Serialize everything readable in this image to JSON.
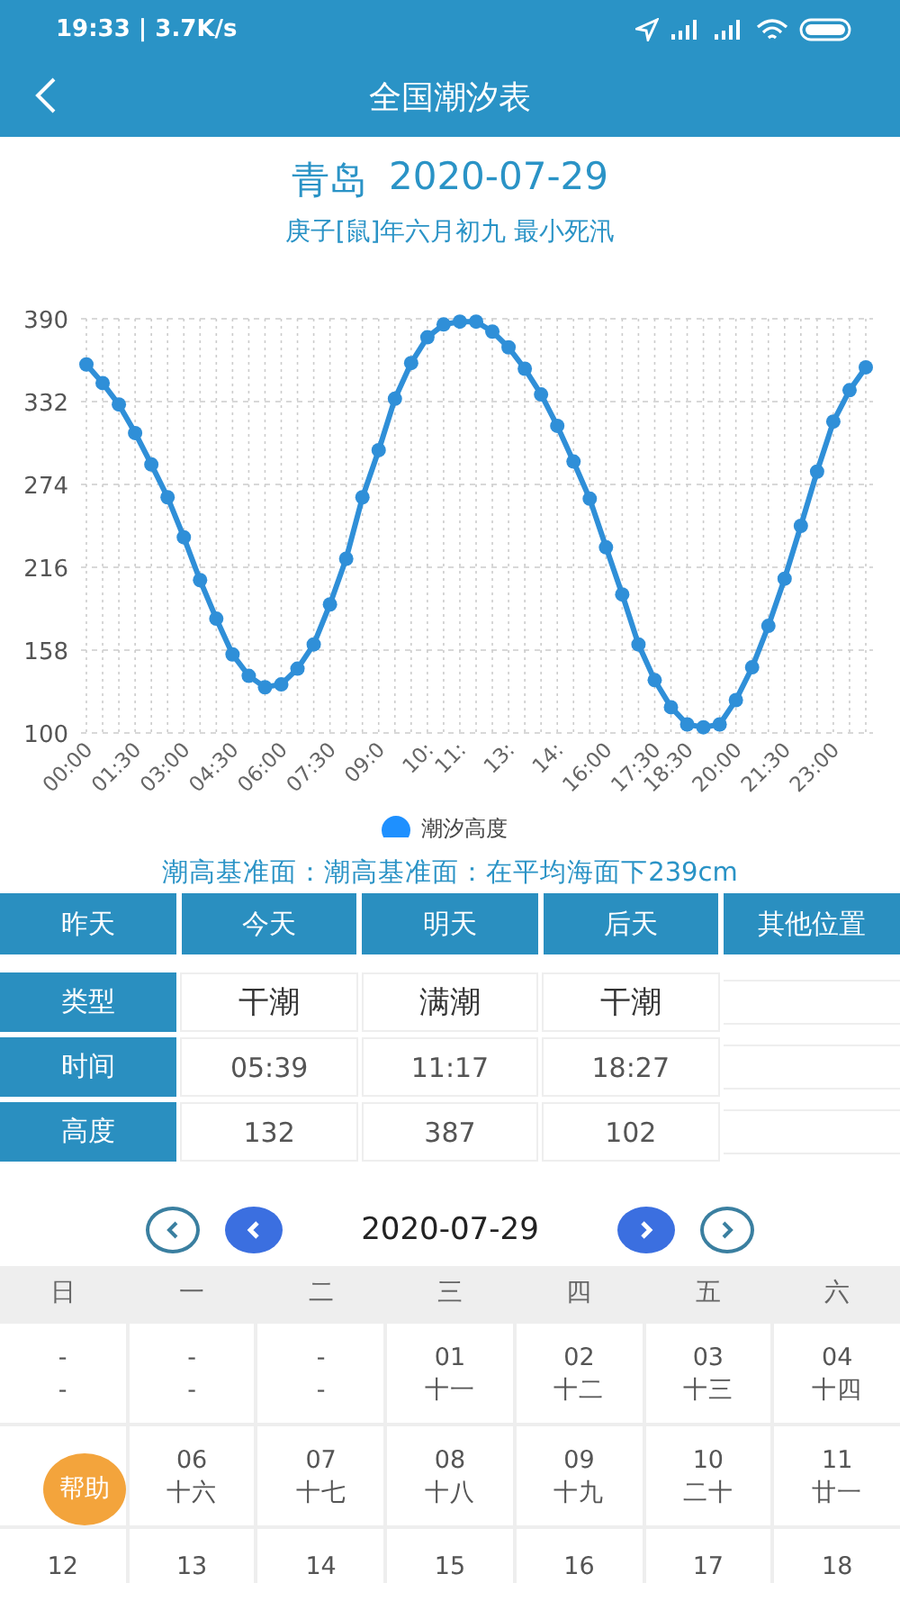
{
  "status_bar": {
    "time_speed": "19:33 | 3.7K/s"
  },
  "header": {
    "title": "全国潮汐表"
  },
  "place_date": {
    "place": "青岛",
    "date": "2020-07-29"
  },
  "lunar_info": "庚子[鼠]年六月初九 最小死汛",
  "chart": {
    "chart_data": {
      "type": "line",
      "grid": true,
      "x": [
        0,
        0.5,
        1,
        1.5,
        2,
        2.5,
        3,
        3.5,
        4,
        4.5,
        5,
        5.5,
        6,
        6.5,
        7,
        7.5,
        8,
        8.5,
        9,
        9.5,
        10,
        10.5,
        11,
        11.5,
        12,
        12.5,
        13,
        13.5,
        14,
        14.5,
        15,
        15.5,
        16,
        16.5,
        17,
        17.5,
        18,
        18.5,
        19,
        19.5,
        20,
        20.5,
        21,
        21.5,
        22,
        22.5,
        23,
        23.5,
        24
      ],
      "series": [
        {
          "name": "潮汐高度",
          "color": "#2f8fd8",
          "marker": "circle",
          "values": [
            358,
            345,
            330,
            310,
            288,
            265,
            237,
            207,
            180,
            155,
            140,
            132,
            134,
            145,
            162,
            190,
            222,
            265,
            298,
            334,
            359,
            377,
            386,
            388,
            388,
            381,
            370,
            355,
            337,
            315,
            290,
            264,
            230,
            197,
            162,
            137,
            118,
            106,
            104,
            106,
            123,
            146,
            175,
            208,
            245,
            283,
            318,
            340,
            356
          ]
        }
      ],
      "xlim": [
        0,
        24
      ],
      "ylim": [
        100,
        390
      ],
      "yticks": [
        100,
        158,
        216,
        274,
        332,
        390
      ],
      "xticks": [
        {
          "value": 0,
          "label": "00:00"
        },
        {
          "value": 1.5,
          "label": "01:30"
        },
        {
          "value": 3,
          "label": "03:00"
        },
        {
          "value": 4.5,
          "label": "04:30"
        },
        {
          "value": 6,
          "label": "06:00"
        },
        {
          "value": 7.5,
          "label": "07:30"
        },
        {
          "value": 9,
          "label": "09:0"
        },
        {
          "value": 10.5,
          "label": "10:"
        },
        {
          "value": 11.5,
          "label": "11:"
        },
        {
          "value": 13,
          "label": "13:"
        },
        {
          "value": 14.5,
          "label": "14:"
        },
        {
          "value": 16,
          "label": "16:00"
        },
        {
          "value": 17.5,
          "label": "17:30"
        },
        {
          "value": 18.5,
          "label": "18:30"
        },
        {
          "value": 20,
          "label": "20:00"
        },
        {
          "value": 21.5,
          "label": "21:30"
        },
        {
          "value": 23,
          "label": "23:00"
        }
      ]
    }
  },
  "datum": "潮高基准面：潮高基准面：在平均海面下239cm",
  "day_tabs": [
    "昨天",
    "今天",
    "明天",
    "后天",
    "其他位置"
  ],
  "tide_table": {
    "rows": [
      {
        "header": "类型",
        "cells": [
          "干潮",
          "满潮",
          "干潮"
        ]
      },
      {
        "header": "时间",
        "cells": [
          "05:39",
          "11:17",
          "18:27"
        ]
      },
      {
        "header": "高度",
        "cells": [
          "132",
          "387",
          "102"
        ]
      }
    ]
  },
  "calendar": {
    "month": "2020-07-29",
    "weekdays": [
      "日",
      "一",
      "二",
      "三",
      "四",
      "五",
      "六"
    ],
    "weeks": [
      [
        {
          "day": "-",
          "lunar": "-"
        },
        {
          "day": "-",
          "lunar": "-"
        },
        {
          "day": "-",
          "lunar": "-"
        },
        {
          "day": "01",
          "lunar": "十一"
        },
        {
          "day": "02",
          "lunar": "十二"
        },
        {
          "day": "03",
          "lunar": "十三"
        },
        {
          "day": "04",
          "lunar": "十四"
        }
      ],
      [
        {
          "day": "06",
          "lunar": "十六"
        },
        {
          "day": "07",
          "lunar": "十七"
        },
        {
          "day": "08",
          "lunar": "十八"
        },
        {
          "day": "09",
          "lunar": "十九"
        },
        {
          "day": "10",
          "lunar": "二十"
        },
        {
          "day": "11",
          "lunar": "廿一"
        }
      ],
      [
        {
          "day": "12"
        },
        {
          "day": "13"
        },
        {
          "day": "14"
        },
        {
          "day": "15"
        },
        {
          "day": "16"
        },
        {
          "day": "17"
        },
        {
          "day": "18"
        }
      ]
    ]
  },
  "help_button": "帮助"
}
